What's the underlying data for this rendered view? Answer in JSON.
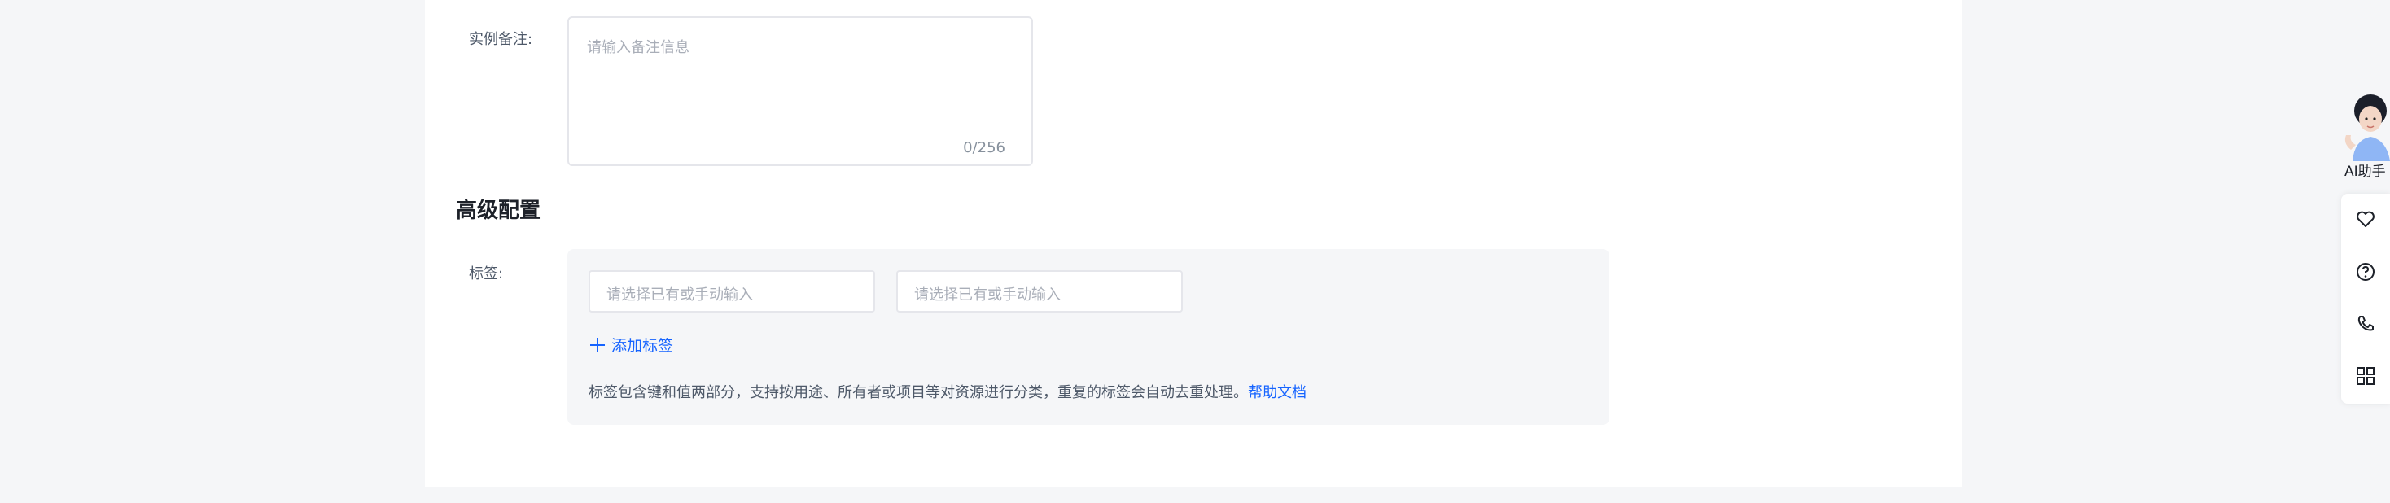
{
  "remark": {
    "label": "实例备注:",
    "placeholder": "请输入备注信息",
    "counter": "0/256"
  },
  "advanced": {
    "section_title": "高级配置",
    "tags_label": "标签:",
    "tag_key_placeholder": "请选择已有或手动输入",
    "tag_value_placeholder": "请选择已有或手动输入",
    "add_tag": "添加标签",
    "hint_text": "标签包含键和值两部分，支持按用途、所有者或项目等对资源进行分类，重复的标签会自动去重处理。",
    "help_link": "帮助文档"
  },
  "sidebar": {
    "ai_label": "AI助手",
    "tools": [
      "heart-icon",
      "question-icon",
      "phone-icon",
      "apps-icon"
    ]
  }
}
